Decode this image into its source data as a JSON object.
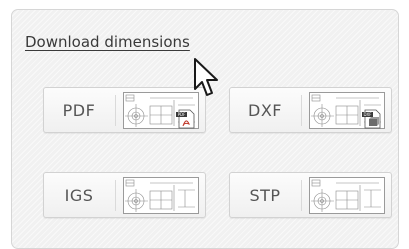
{
  "panel": {
    "download_link": "Download dimensions"
  },
  "buttons": [
    {
      "label": "PDF",
      "thumbnail_icon": "drawing-thumbnail-icon",
      "badge_icon": "pdf-file-icon"
    },
    {
      "label": "DXF",
      "thumbnail_icon": "drawing-thumbnail-icon",
      "badge_icon": "dxf-file-icon"
    },
    {
      "label": "IGS",
      "thumbnail_icon": "drawing-thumbnail-icon"
    },
    {
      "label": "STP",
      "thumbnail_icon": "drawing-thumbnail-icon"
    }
  ],
  "cursor": {
    "icon": "arrow-cursor-icon"
  },
  "colors": {
    "panel_background": "#f1f1f1",
    "text": "#555555",
    "link_text": "#3a3a3a",
    "border": "#d2d2d2"
  }
}
